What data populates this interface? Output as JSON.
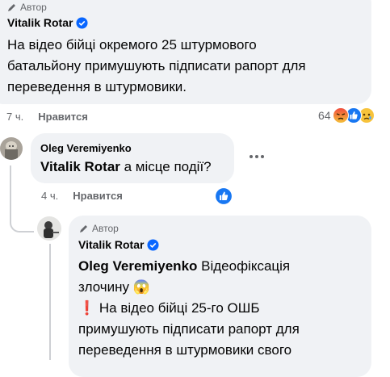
{
  "comment1": {
    "author_tag": "Автор",
    "name": "Vitalik Rotar",
    "text_lines": [
      "На відео бійці окремого 25 штурмового",
      "батальйону примушують підписати рапорт для",
      "переведення в штурмовики."
    ],
    "time": "7 ч.",
    "like_label": "Нравится",
    "reaction_count": "64",
    "reactions": [
      "angry-icon",
      "like-icon",
      "sad-icon"
    ]
  },
  "comment2": {
    "name": "Oleg Veremiyenko",
    "mention": "Vitalik Rotar",
    "text": " а місце події?",
    "time": "4 ч.",
    "like_label": "Нравится",
    "reactions": [
      "like-icon"
    ]
  },
  "comment3": {
    "author_tag": "Автор",
    "name": "Vitalik Rotar",
    "mention": "Oleg Veremiyenko",
    "line1_rest": " Відеофіксація",
    "line2": "злочину ",
    "line2_emoji": "😱",
    "line3_emoji": "❗",
    "line3": "На відео бійці 25-го ОШБ",
    "line4": "примушують підписати рапорт для",
    "line5": "переведення в штурмовики свого"
  },
  "colors": {
    "bubble": "#f0f2f5",
    "verified": "#0866ff",
    "meta_text": "#65676b",
    "thread_line": "#ced0d4"
  }
}
